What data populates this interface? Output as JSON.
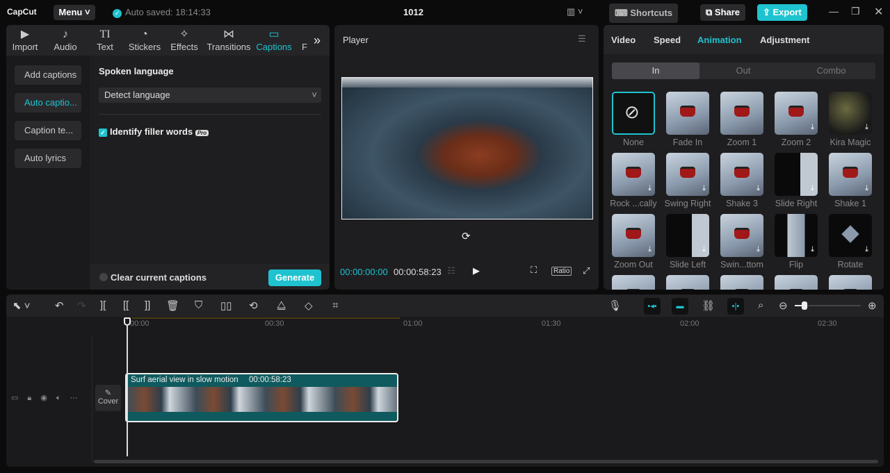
{
  "app": {
    "logo": "CapCut",
    "menu": "Menu",
    "autosave": "Auto saved: 18:14:33",
    "title": "1012",
    "shortcuts": "Shortcuts",
    "share": "Share",
    "export": "Export",
    "accent": "#1fc3cf"
  },
  "tabs": [
    {
      "label": "Import",
      "icon": "▶"
    },
    {
      "label": "Audio",
      "icon": "♪"
    },
    {
      "label": "Text",
      "icon": "TI"
    },
    {
      "label": "Stickers",
      "icon": "◔"
    },
    {
      "label": "Effects",
      "icon": "✧"
    },
    {
      "label": "Transitions",
      "icon": "⋈"
    },
    {
      "label": "Captions",
      "icon": "▭"
    },
    {
      "label": "F",
      "icon": ""
    }
  ],
  "captions": {
    "side": [
      "Add captions",
      "Auto captio...",
      "Caption te...",
      "Auto lyrics"
    ],
    "spoken_language": "Spoken language",
    "language_value": "Detect language",
    "filler": "Identify filler words",
    "pro": "Pro",
    "clear": "Clear current captions",
    "generate": "Generate"
  },
  "player": {
    "title": "Player",
    "current": "00:00:00:00",
    "duration": "00:00:58:23",
    "ratio": "Ratio"
  },
  "right": {
    "tabs": [
      "Video",
      "Speed",
      "Animation",
      "Adjustment"
    ],
    "sub": [
      "In",
      "Out",
      "Combo"
    ],
    "items": [
      "None",
      "Fade In",
      "Zoom 1",
      "Zoom 2",
      "Kira Magic",
      "Rock ...cally",
      "Swing Right",
      "Shake 3",
      "Slide Right",
      "Shake 1",
      "Zoom Out",
      "Slide Left",
      "Swin...ttom",
      "Flip",
      "Rotate"
    ]
  },
  "timeline": {
    "ticks": [
      "00:00",
      "00:30",
      "01:00",
      "01:30",
      "02:00",
      "02:30"
    ],
    "clip_name": "Surf aerial view in slow motion",
    "clip_duration": "00:00:58:23",
    "cover": "Cover",
    "zoom_level": 0.15
  }
}
